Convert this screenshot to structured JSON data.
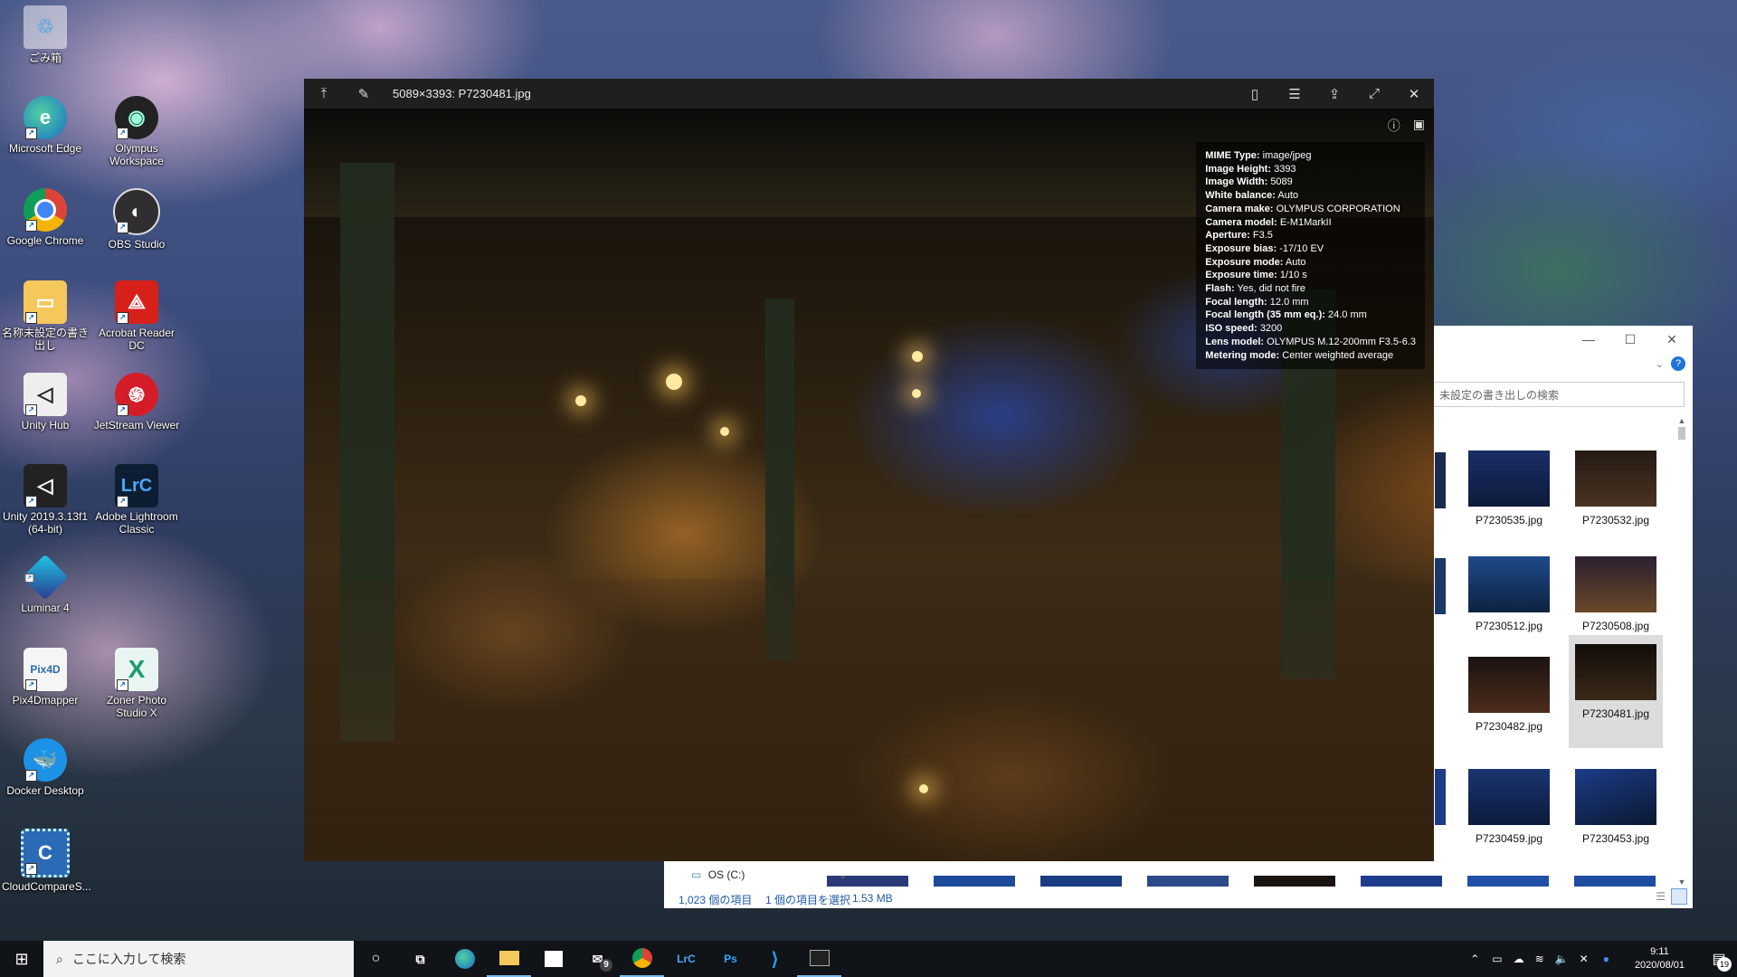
{
  "desktop": {
    "icons": [
      {
        "label": "ごみ箱",
        "icon": "recycle-bin-icon"
      },
      {
        "label": "Microsoft Edge",
        "icon": "edge-icon"
      },
      {
        "label": "Olympus Workspace",
        "icon": "olympus-workspace-icon"
      },
      {
        "label": "Google Chrome",
        "icon": "chrome-icon"
      },
      {
        "label": "OBS Studio",
        "icon": "obs-icon"
      },
      {
        "label": "名称未設定の書き出し",
        "icon": "folder-icon"
      },
      {
        "label": "Acrobat Reader DC",
        "icon": "acrobat-icon"
      },
      {
        "label": "Unity Hub",
        "icon": "unity-hub-icon"
      },
      {
        "label": "JetStream Viewer",
        "icon": "jetstream-icon"
      },
      {
        "label": "Unity 2019.3.13f1 (64-bit)",
        "icon": "unity-icon"
      },
      {
        "label": "Adobe Lightroom Classic",
        "icon": "lightroom-icon"
      },
      {
        "label": "Luminar 4",
        "icon": "luminar-icon"
      },
      {
        "label": "Pix4Dmapper",
        "icon": "pix4d-icon"
      },
      {
        "label": "Zoner Photo Studio X",
        "icon": "zoner-icon"
      },
      {
        "label": "Docker Desktop",
        "icon": "docker-icon"
      },
      {
        "label": "CloudCompareS...",
        "icon": "cloudcompare-icon"
      }
    ]
  },
  "viewer": {
    "title": "5089×3393: P7230481.jpg",
    "exif": [
      {
        "k": "MIME Type:",
        "v": "image/jpeg"
      },
      {
        "k": "Image Height:",
        "v": "3393"
      },
      {
        "k": "Image Width:",
        "v": "5089"
      },
      {
        "k": "White balance:",
        "v": "Auto"
      },
      {
        "k": "Camera make:",
        "v": "OLYMPUS CORPORATION"
      },
      {
        "k": "Camera model:",
        "v": "E-M1MarkII"
      },
      {
        "k": "Aperture:",
        "v": "F3.5"
      },
      {
        "k": "Exposure bias:",
        "v": "-17/10 EV"
      },
      {
        "k": "Exposure mode:",
        "v": "Auto"
      },
      {
        "k": "Exposure time:",
        "v": "1/10 s"
      },
      {
        "k": "Flash:",
        "v": "Yes, did not fire"
      },
      {
        "k": "Focal length:",
        "v": "12.0 mm"
      },
      {
        "k": "Focal length (35 mm eq.):",
        "v": "24.0 mm"
      },
      {
        "k": "ISO speed:",
        "v": "3200"
      },
      {
        "k": "Lens model:",
        "v": "OLYMPUS M.12-200mm F3.5-6.3"
      },
      {
        "k": "Metering mode:",
        "v": "Center weighted average"
      }
    ]
  },
  "explorer": {
    "search_placeholder": "未設定の書き出しの検索",
    "thumbnails": [
      {
        "name": "P7230535.jpg",
        "color": "#1d3570"
      },
      {
        "name": "P7230532.jpg",
        "color": "#3a2a1a"
      },
      {
        "name": "P7230512.jpg",
        "color": "#1e4a8a"
      },
      {
        "name": "P7230508.jpg",
        "color": "#5a3a22"
      },
      {
        "name": "P7230482.jpg",
        "color": "#3e2418"
      },
      {
        "name": "P7230481.jpg",
        "color": "#2a2016"
      },
      {
        "name": "P7230459.jpg",
        "color": "#1d3e78"
      },
      {
        "name": "P7230453.jpg",
        "color": "#1c3c88"
      }
    ],
    "nav_item": "OS (C:)",
    "status_count": "1,023 個の項目",
    "status_selected": "1 個の項目を選択",
    "status_size": "1.53 MB"
  },
  "taskbar": {
    "search_placeholder": "ここに入力して検索",
    "mail_badge": "9",
    "apps": [
      "LrC",
      "Ps"
    ],
    "time": "9:11",
    "date": "2020/08/01",
    "notification_count": "19"
  },
  "colors": {
    "taskbar": "#101418",
    "accent": "#1e72d8"
  }
}
